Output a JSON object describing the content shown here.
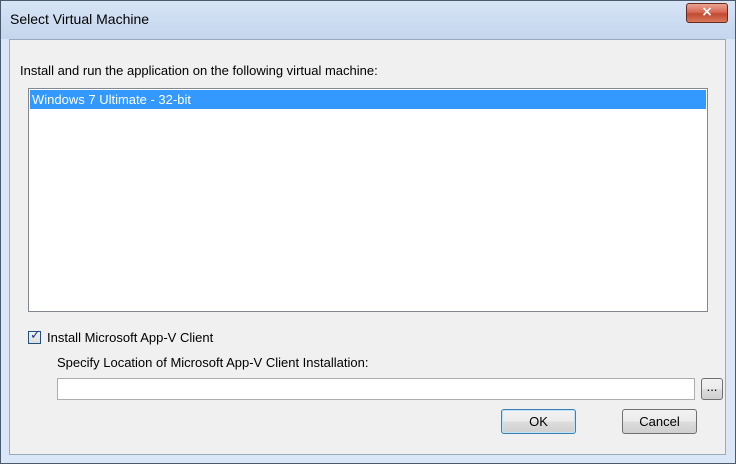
{
  "window": {
    "title": "Select Virtual Machine",
    "close_label": "×"
  },
  "instructions": "Install and run the application on the following virtual machine:",
  "vm_list": {
    "items": [
      "Windows 7 Ultimate - 32-bit"
    ],
    "selected_index": 0
  },
  "install_client": {
    "label": "Install Microsoft App-V Client",
    "checked": true,
    "checkmark": "✓"
  },
  "client_location": {
    "label": "Specify Location of Microsoft App-V Client Installation:",
    "value": "",
    "placeholder": ""
  },
  "browse_button": {
    "label": "..."
  },
  "buttons": {
    "ok": "OK",
    "cancel": "Cancel"
  },
  "colors": {
    "selection": "#3399ff",
    "close_button": "#c94c32",
    "frame": "#dbe7f6"
  }
}
